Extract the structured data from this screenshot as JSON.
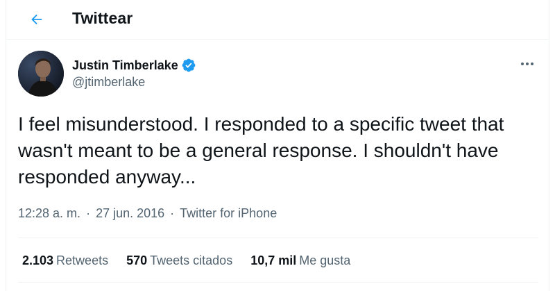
{
  "header": {
    "title": "Twittear",
    "back_icon": "arrow-left-icon",
    "accent_color": "#1d9bf0"
  },
  "tweet": {
    "author": {
      "name": "Justin Timberlake",
      "handle": "@jtimberlake",
      "verified": true,
      "verified_icon": "verified-badge-icon",
      "avatar_icon": "avatar"
    },
    "more_icon": "more-horizontal-icon",
    "text": "I feel misunderstood. I responded to a specific tweet that wasn't meant to be a general response. I shouldn't have responded anyway...",
    "time": "12:28 a. m.",
    "date": "27 jun. 2016",
    "separator": "·",
    "source": "Twitter for iPhone"
  },
  "stats": {
    "retweets_count": "2.103",
    "retweets_label": "Retweets",
    "quotes_count": "570",
    "quotes_label": "Tweets citados",
    "likes_count": "10,7 mil",
    "likes_label": "Me gusta"
  }
}
